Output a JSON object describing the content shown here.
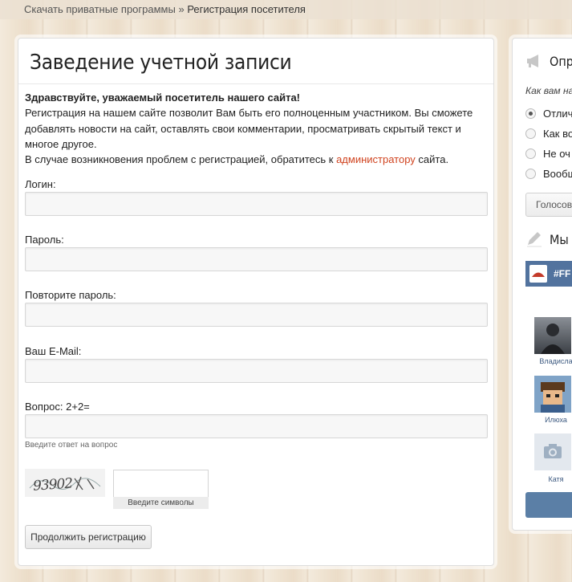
{
  "breadcrumb": {
    "home": "Скачать приватные программы",
    "separator": "»",
    "current": "Регистрация посетителя"
  },
  "main": {
    "title": "Заведение учетной записи",
    "greeting": "Здравствуйте, уважаемый посетитель нашего сайта!",
    "intro_text": "Регистрация на нашем сайте позволит Вам быть его полноценным участником. Вы сможете добавлять новости на сайт, оставлять свои комментарии, просматривать скрытый текст и многое другое.",
    "problems_prefix": "В случае возникновения проблем с регистрацией, обратитесь к",
    "problems_link": "администратору",
    "problems_suffix": "сайта.",
    "fields": {
      "login_label": "Логин:",
      "password_label": "Пароль:",
      "password_repeat_label": "Повторите пароль:",
      "email_label": "Ваш E-Mail:",
      "question_label": "Вопрос: 2+2=",
      "question_hint": "Введите ответ на вопрос"
    },
    "captcha": {
      "image_text": "93902",
      "hint": "Введите символы"
    },
    "submit_label": "Продолжить регистрацию"
  },
  "sidebar": {
    "poll": {
      "title": "Опр",
      "question": "Как вам на",
      "options": [
        "Отлич",
        "Как во",
        "Не оч",
        "Вообщ"
      ],
      "selected_index": 0,
      "vote_label": "Голосов"
    },
    "vk_widget": {
      "title": "Мы",
      "group_label": "#FF",
      "members": [
        "Владисла",
        "Илюха",
        "Катя"
      ]
    }
  },
  "colors": {
    "link": "#d0431f",
    "vk_blue": "#52739e",
    "background": "#efe3d1"
  }
}
